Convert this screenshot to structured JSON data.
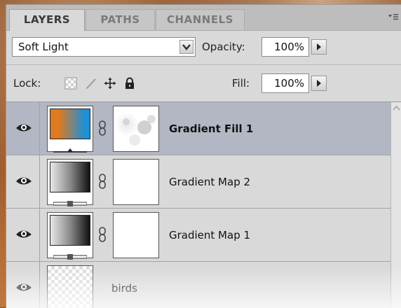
{
  "tabs": [
    {
      "label": "LAYERS",
      "active": true
    },
    {
      "label": "PATHS",
      "active": false
    },
    {
      "label": "CHANNELS",
      "active": false
    }
  ],
  "blend": {
    "mode": "Soft Light",
    "opacity_label": "Opacity:",
    "opacity_value": "100%"
  },
  "lock": {
    "label": "Lock:",
    "fill_label": "Fill:",
    "fill_value": "100%"
  },
  "layers": [
    {
      "name": "Gradient Fill 1",
      "selected": true,
      "visible": true
    },
    {
      "name": "Gradient Map 2",
      "selected": false,
      "visible": true
    },
    {
      "name": "Gradient Map 1",
      "selected": false,
      "visible": true
    },
    {
      "name": "birds",
      "selected": false,
      "visible": true
    }
  ],
  "colors": {
    "panel": "#d9d9d9",
    "selected_row": "#b3b7c4",
    "gradient_fill_start": "#e07a1e",
    "gradient_fill_end": "#1f8fd6"
  },
  "icons": {
    "eye": "eye-icon",
    "chain": "chain-link-icon",
    "lock_transparent": "lock-transparent-pixels-icon",
    "lock_image": "lock-image-pixels-icon",
    "lock_position": "lock-position-icon",
    "lock_all": "lock-all-icon",
    "panel_menu": "panel-menu-icon"
  }
}
